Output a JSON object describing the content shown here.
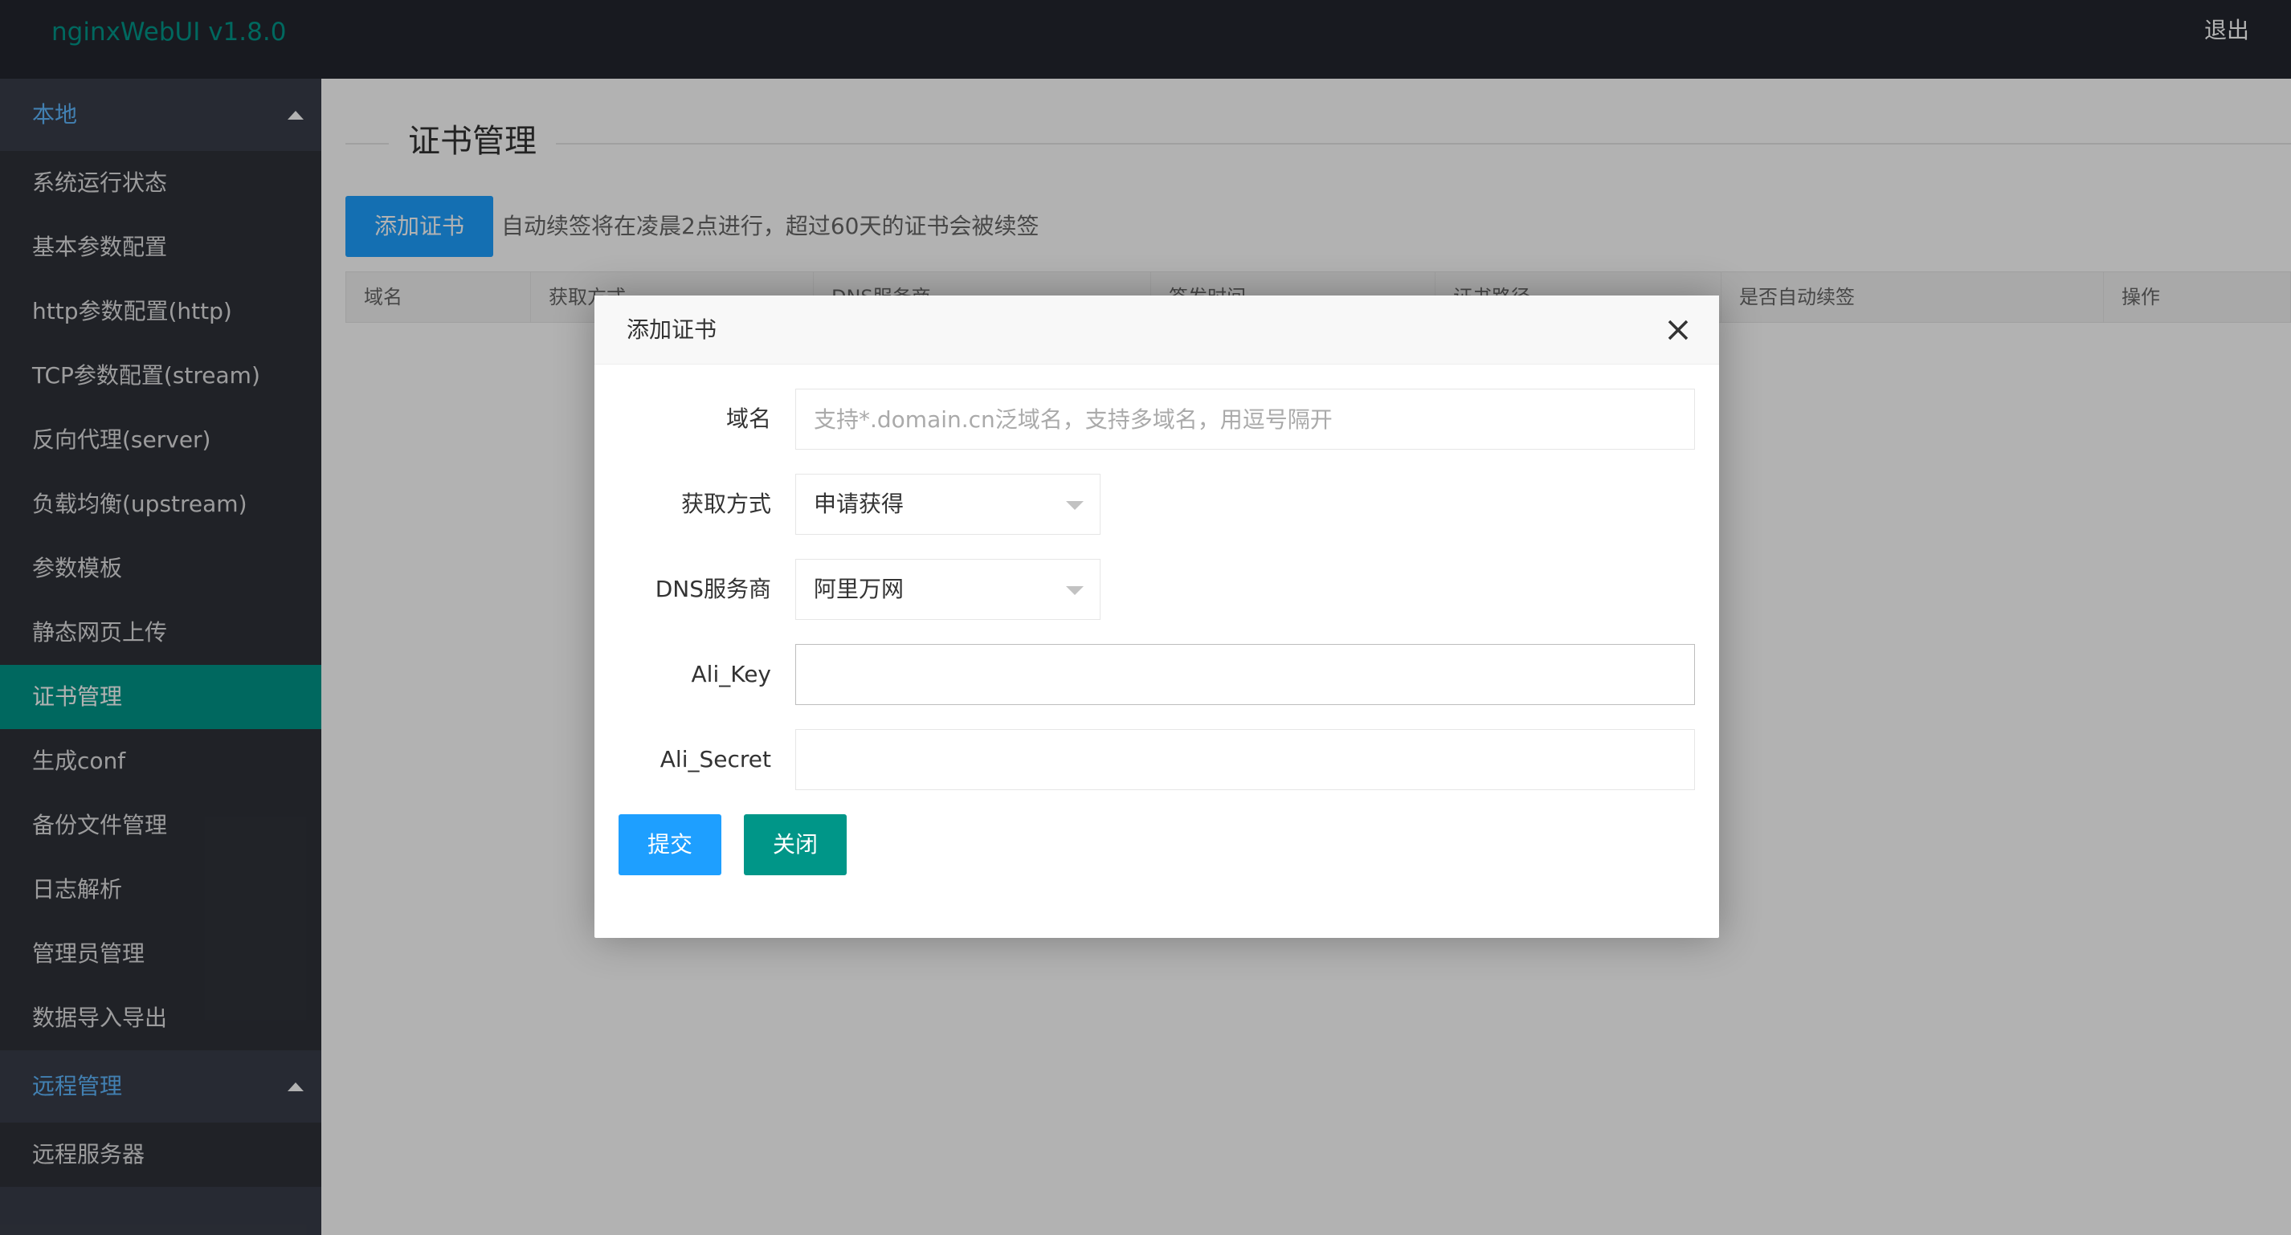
{
  "app": {
    "title": "nginxWebUI v1.8.0",
    "logout_label": "退出"
  },
  "sidebar": {
    "group_local": "本地",
    "items": [
      "系统运行状态",
      "基本参数配置",
      "http参数配置(http)",
      "TCP参数配置(stream)",
      "反向代理(server)",
      "负载均衡(upstream)",
      "参数模板",
      "静态网页上传",
      "证书管理",
      "生成conf",
      "备份文件管理",
      "日志解析",
      "管理员管理",
      "数据导入导出"
    ],
    "active_item": "证书管理",
    "group_remote": "远程管理",
    "remote_items": [
      "远程服务器"
    ]
  },
  "page": {
    "title": "证书管理",
    "add_button": "添加证书",
    "hint": "自动续签将在凌晨2点进行，超过60天的证书会被续签"
  },
  "table": {
    "columns": [
      "域名",
      "获取方式",
      "DNS服务商",
      "签发时间",
      "证书路径",
      "是否自动续签",
      "操作"
    ]
  },
  "modal": {
    "title": "添加证书",
    "fields": {
      "domain_label": "域名",
      "domain_placeholder": "支持*.domain.cn泛域名，支持多域名，用逗号隔开",
      "method_label": "获取方式",
      "method_value": "申请获得",
      "dns_label": "DNS服务商",
      "dns_value": "阿里万网",
      "ali_key_label": "Ali_Key",
      "ali_key_value": "",
      "ali_secret_label": "Ali_Secret",
      "ali_secret_value": ""
    },
    "submit_label": "提交",
    "close_label": "关闭"
  },
  "colors": {
    "header_bg": "#23262e",
    "sidebar_bg": "#393d49",
    "accent_green": "#009688",
    "accent_blue": "#1E9FFF"
  },
  "icons": {
    "close": "close-icon",
    "caret": "caret-up-icon",
    "dropdown": "dropdown-triangle-icon"
  }
}
